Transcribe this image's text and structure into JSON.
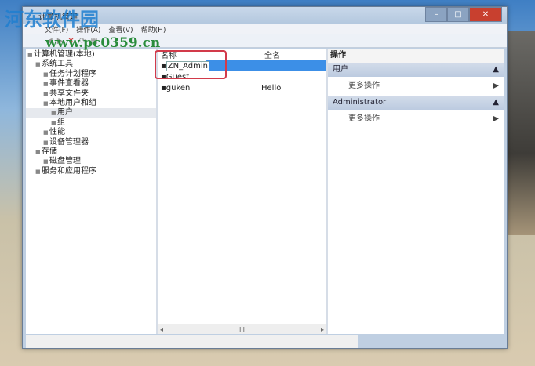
{
  "window": {
    "title": "计算机管理",
    "min": "–",
    "max": "□",
    "close": "✕"
  },
  "menu": [
    "文件(F)",
    "操作(A)",
    "查看(V)",
    "帮助(H)"
  ],
  "tree": [
    {
      "label": "计算机管理(本地)",
      "level": 0
    },
    {
      "label": "系统工具",
      "level": 1
    },
    {
      "label": "任务计划程序",
      "level": 2
    },
    {
      "label": "事件查看器",
      "level": 2
    },
    {
      "label": "共享文件夹",
      "level": 2
    },
    {
      "label": "本地用户和组",
      "level": 2
    },
    {
      "label": "用户",
      "level": 3,
      "selected": true
    },
    {
      "label": "组",
      "level": 3
    },
    {
      "label": "性能",
      "level": 2
    },
    {
      "label": "设备管理器",
      "level": 2
    },
    {
      "label": "存储",
      "level": 1
    },
    {
      "label": "磁盘管理",
      "level": 2
    },
    {
      "label": "服务和应用程序",
      "level": 1
    }
  ],
  "list": {
    "columns": [
      "名称",
      "全名"
    ],
    "rows": [
      {
        "name": "ZN_Admin",
        "full": "",
        "editing": true
      },
      {
        "name": "Guest",
        "full": ""
      },
      {
        "name": "guken",
        "full": "Hello"
      }
    ],
    "scroll_mid": "III"
  },
  "actions": {
    "header": "操作",
    "groups": [
      {
        "title": "用户",
        "item": "更多操作"
      },
      {
        "title": "Administrator",
        "item": "更多操作"
      }
    ]
  },
  "watermark": {
    "name": "河东软件园",
    "url": "www.pc0359.cn"
  }
}
